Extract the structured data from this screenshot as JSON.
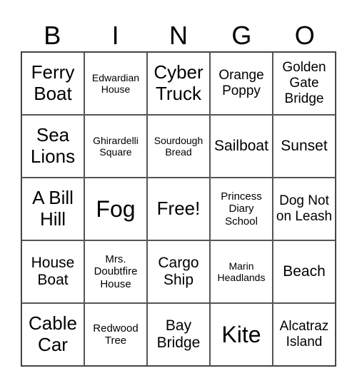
{
  "header": [
    "B",
    "I",
    "N",
    "G",
    "O"
  ],
  "cells": [
    [
      "Ferry Boat",
      "Edwardian House",
      "Cyber Truck",
      "Orange Poppy",
      "Golden Gate Bridge"
    ],
    [
      "Sea Lions",
      "Ghirardelli Square",
      "Sourdough Bread",
      "Sailboat",
      "Sunset"
    ],
    [
      "A Bill Hill",
      "Fog",
      "Free!",
      "Princess Diary School",
      "Dog Not on Leash"
    ],
    [
      "House Boat",
      "Mrs. Doubtfire House",
      "Cargo Ship",
      "Marin Headlands",
      "Beach"
    ],
    [
      "Cable Car",
      "Redwood Tree",
      "Bay Bridge",
      "Kite",
      "Alcatraz Island"
    ]
  ]
}
